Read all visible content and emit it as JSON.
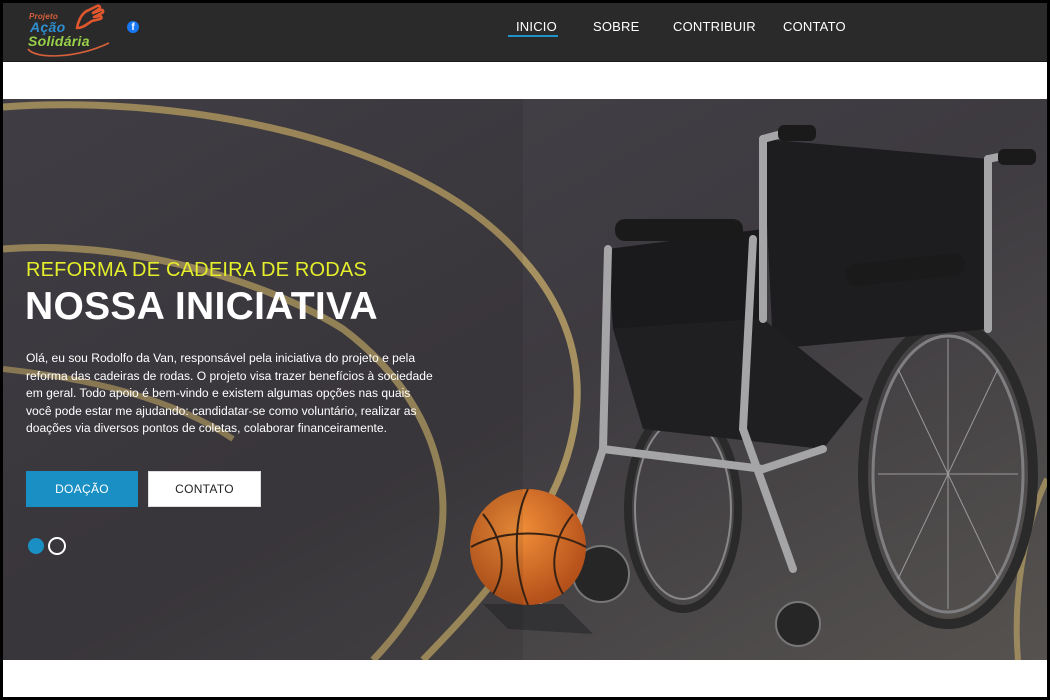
{
  "header": {
    "logo": {
      "line1": "Projeto",
      "line2": "Ação",
      "line3": "Solidária"
    },
    "social": {
      "facebook_icon": "facebook-icon",
      "glyph": "f"
    },
    "nav": [
      {
        "label": "INICIO",
        "active": true
      },
      {
        "label": "SOBRE",
        "active": false
      },
      {
        "label": "CONTRIBUIR",
        "active": false
      },
      {
        "label": "CONTATO",
        "active": false
      }
    ],
    "accent_color": "#1e93c9"
  },
  "hero": {
    "subtitle": "REFORMA DE CADEIRA DE RODAS",
    "title": "NOSSA INICIATIVA",
    "text": "Olá, eu sou Rodolfo da Van, responsável pela iniciativa do projeto e pela reforma das cadeiras de rodas. O projeto visa trazer benefícios à sociedade em geral. Todo apoio é bem-vindo e existem algumas opções nas quais você pode estar me ajudando: candidatar-se como voluntário, realizar as doações via diversos pontos de coletas, colaborar financeiramente.",
    "buttons": {
      "primary": "DOAÇÃO",
      "secondary": "CONTATO"
    },
    "slides": {
      "total": 2,
      "active": 1
    },
    "colors": {
      "subtitle": "#e5ee2b",
      "button": "#1a8fc4"
    }
  }
}
